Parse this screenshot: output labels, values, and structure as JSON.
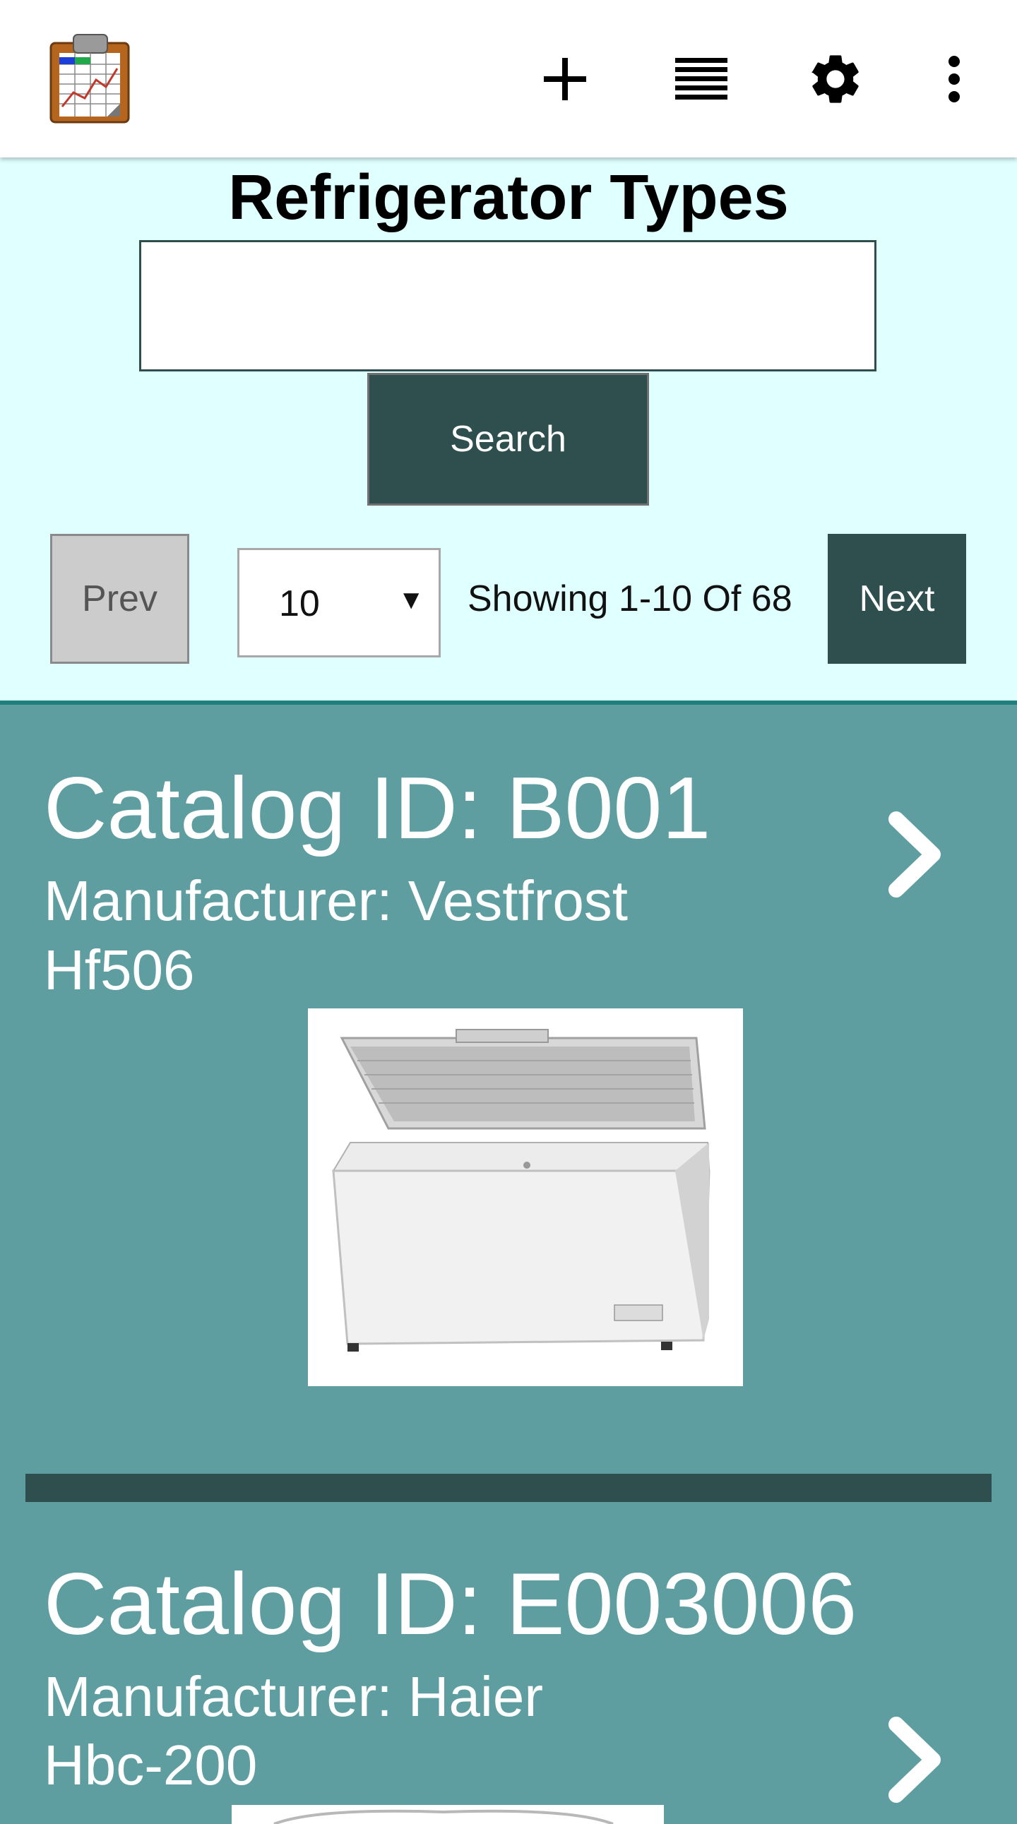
{
  "toolbar": {
    "app_icon": "clipboard-chart-icon",
    "add_icon": "plus-icon",
    "list_icon": "list-lines-icon",
    "settings_icon": "gear-icon",
    "more_icon": "more-vert-icon"
  },
  "page": {
    "title": "Refrigerator Types"
  },
  "search": {
    "value": "",
    "button_label": "Search"
  },
  "pagination": {
    "prev_label": "Prev",
    "page_size": "10",
    "showing_text": "Showing 1-10 Of 68",
    "next_label": "Next"
  },
  "items": [
    {
      "catalog_id": "Catalog ID: B001",
      "manufacturer": "Manufacturer: Vestfrost",
      "model": "Hf506"
    },
    {
      "catalog_id": "Catalog ID: E003006",
      "manufacturer": "Manufacturer: Haier",
      "model": "Hbc-200"
    }
  ],
  "colors": {
    "primary_dark": "#2f4f4f",
    "panel_bg": "#e0ffff",
    "list_bg": "#5f9ea0",
    "accent_border": "#1f7f7c"
  }
}
